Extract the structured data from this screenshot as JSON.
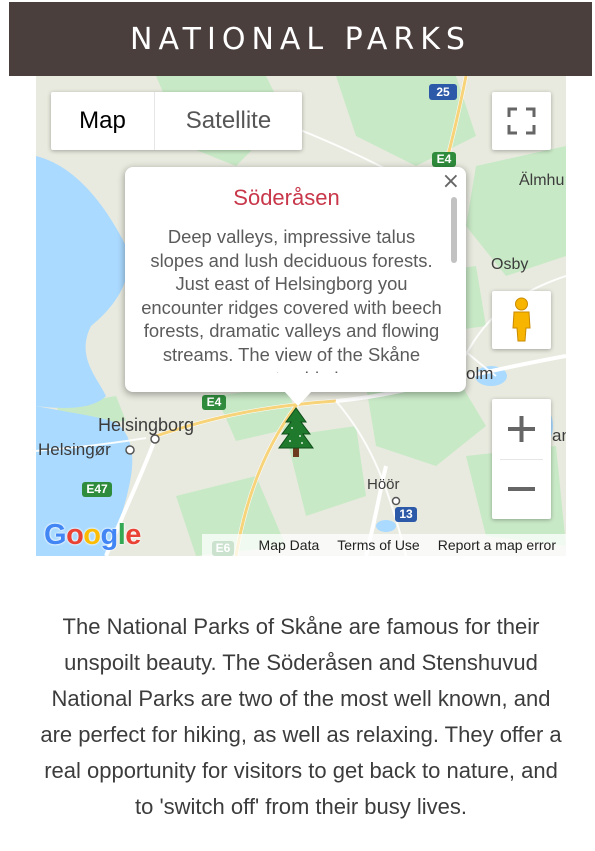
{
  "header": {
    "title": "NATIONAL PARKS"
  },
  "map": {
    "type_control": {
      "map_label": "Map",
      "satellite_label": "Satellite"
    },
    "popup": {
      "title": "Söderåsen",
      "close": "×",
      "body": "Deep valleys, impressive talus slopes and lush deciduous forests. Just east of Helsingborg you encounter ridges covered with beech forests, dramatic valleys and flowing streams. The view of the Skåne countryside is"
    },
    "places": {
      "helsingborg": "Helsingborg",
      "helsingor": "Helsingør",
      "hoor": "Höör",
      "osby": "Osby",
      "almhult": "Älmhu",
      "olm": "olm",
      "an": "an"
    },
    "shields": {
      "r25": "25",
      "e4_top": "E4",
      "e4_mid": "E4",
      "e47": "E47",
      "r13": "13",
      "e6": "E6"
    },
    "google_logo": "Google",
    "footer": {
      "map_data": "Map Data",
      "terms": "Terms of Use",
      "report": "Report a map error"
    },
    "marker_icon": "tree-marker-icon",
    "colors": {
      "water": "#aadaff",
      "land": "#e8eadf",
      "park": "#c5e8c5",
      "accent": "#c8374a"
    }
  },
  "description": "The National Parks of Skåne are famous for their unspoilt beauty. The Söderåsen and Stenshuvud National Parks are two of the most well known, and are perfect for hiking, as well as relaxing. They offer a real opportunity for visitors to get back to nature, and to 'switch off' from their busy lives."
}
